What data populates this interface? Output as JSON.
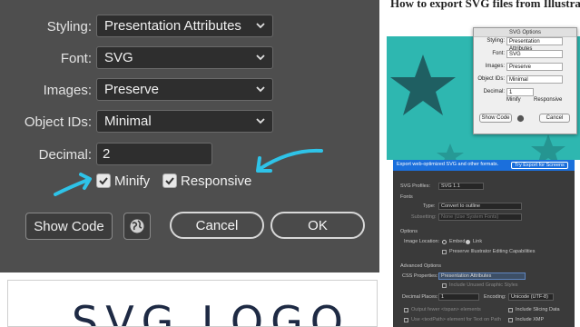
{
  "dialog": {
    "styling_label": "Styling:",
    "styling_value": "Presentation Attributes",
    "font_label": "Font:",
    "font_value": "SVG",
    "images_label": "Images:",
    "images_value": "Preserve",
    "object_ids_label": "Object IDs:",
    "object_ids_value": "Minimal",
    "decimal_label": "Decimal:",
    "decimal_value": "2",
    "minify_label": "Minify",
    "minify_checked": true,
    "responsive_label": "Responsive",
    "responsive_checked": true,
    "show_code_label": "Show Code",
    "cancel_label": "Cancel",
    "ok_label": "OK",
    "globe_icon": "globe-icon"
  },
  "annotation": {
    "arrow_color": "#2ec3e8"
  },
  "logo": {
    "text": "SVG LOGO"
  },
  "article": {
    "title": "How to export SVG files from Illustrator"
  },
  "mini_dialog": {
    "title": "SVG Options",
    "styling_label": "Styling:",
    "styling_value": "Presentation Attributes",
    "font_label": "Font:",
    "font_value": "SVG",
    "images_label": "Images:",
    "images_value": "Preserve",
    "object_ids_label": "Object IDs:",
    "object_ids_value": "Minimal",
    "decimal_label": "Decimal:",
    "decimal_value": "1",
    "minify_label": "Minify",
    "responsive_label": "Responsive",
    "show_code_label": "Show Code",
    "cancel_label": "Cancel"
  },
  "export_panel": {
    "banner_text": "Export web-optimized SVG and other formats.",
    "banner_button": "Try Export for Screens",
    "svg_profiles_label": "SVG Profiles:",
    "svg_profiles_value": "SVG 1.1",
    "fonts_section": "Fonts",
    "type_label": "Type:",
    "type_value": "Convert to outline",
    "subsetting_label": "Subsetting:",
    "subsetting_value": "None (Use System Fonts)",
    "options_section": "Options",
    "image_location_label": "Image Location:",
    "embed_label": "Embed",
    "link_label": "Link",
    "preserve_label": "Preserve Illustrator Editing Capabilities",
    "advanced_section": "Advanced Options",
    "css_label": "CSS Properties:",
    "css_value": "Presentation Attributes",
    "unused_styles_label": "Include Unused Graphic Styles",
    "decimal_places_label": "Decimal Places:",
    "decimal_places_value": "1",
    "encoding_label": "Encoding:",
    "encoding_value": "Unicode (UTF-8)",
    "output_fewer_label": "Output fewer <tspan> elements",
    "slicing_label": "Include Slicing Data",
    "textpath_label": "Use <textPath> element for Text on Path",
    "xmp_label": "Include XMP"
  }
}
